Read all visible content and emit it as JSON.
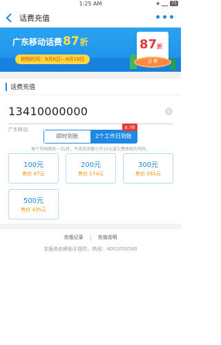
{
  "status_bar": {
    "time": "1:25 AM",
    "battery": "71"
  },
  "nav": {
    "title": "话费充值",
    "more": "•••"
  },
  "banner": {
    "headline_prefix": "广东移动话费",
    "discount_num": "87",
    "discount_suffix": "折",
    "time_text": "抢购时间：8月6日—8月18日",
    "badge_num": "87",
    "badge_suffix": "折",
    "badge_ring": "话 费"
  },
  "section": {
    "title": "话费充值"
  },
  "phone": {
    "number": "13410000000",
    "carrier": "广东移动",
    "clear": "×"
  },
  "toggle": {
    "option_a": "即时到账",
    "option_b": "2个工作日到账",
    "tag": "8.7折"
  },
  "note": "每个号码限充一次/月，不支持余额小于10元或欠费停机的号码。",
  "cards": [
    {
      "face": "100元",
      "price": "售价 87元"
    },
    {
      "face": "200元",
      "price": "售价 174元"
    },
    {
      "face": "300元",
      "price": "售价 261元"
    },
    {
      "face": "500元",
      "price": "售价 435元"
    }
  ],
  "footer": {
    "link_records": "充值记录",
    "link_help": "充值说明",
    "service": "本服务由蜂助手提供，热线：4001050580"
  },
  "colors": {
    "accent": "#1e88e5",
    "price": "#ff8f00",
    "banner": "#1c8de8"
  }
}
